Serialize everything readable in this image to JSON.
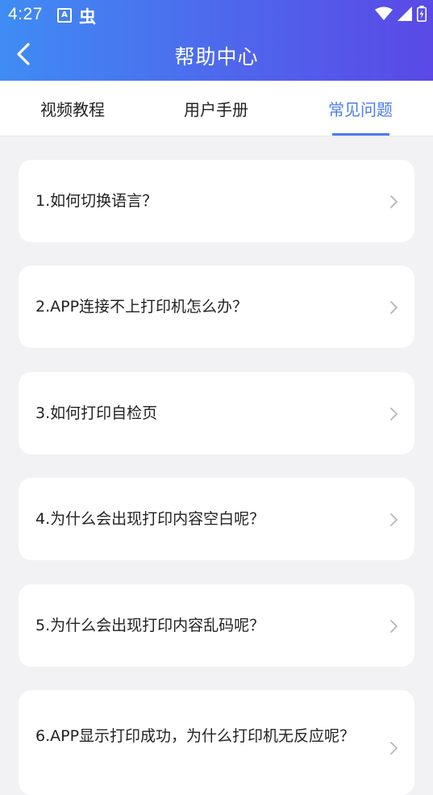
{
  "status_bar": {
    "time": "4:27",
    "a_badge": "A",
    "bug_glyph": "虫"
  },
  "nav": {
    "title": "帮助中心"
  },
  "tabs": [
    {
      "label": "视频教程",
      "active": false
    },
    {
      "label": "用户手册",
      "active": false
    },
    {
      "label": "常见问题",
      "active": true
    }
  ],
  "faq": [
    {
      "text": "1.如何切换语言？"
    },
    {
      "text": "2.APP连接不上打印机怎么办？"
    },
    {
      "text": "3.如何打印自检页"
    },
    {
      "text": "4.为什么会出现打印内容空白呢？"
    },
    {
      "text": "5.为什么会出现打印内容乱码呢？"
    },
    {
      "text": "6.APP显示打印成功，为什么打印机无反应呢？"
    }
  ],
  "colors": {
    "accent": "#4a7cf0",
    "header_start": "#3f8cf4",
    "header_end": "#5a49e6",
    "background": "#f2f2f4"
  }
}
